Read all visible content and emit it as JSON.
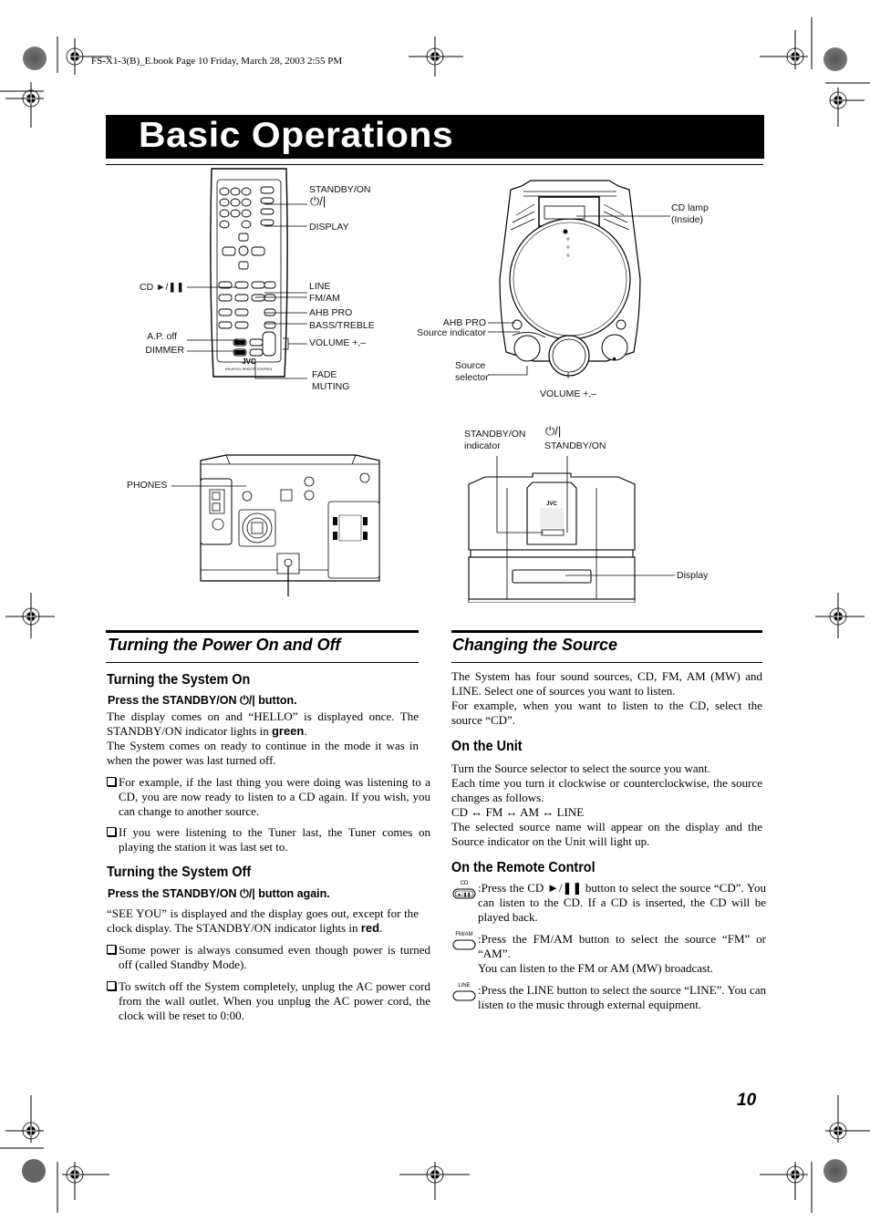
{
  "print_header": "FS-X1-3(B)_E.book  Page 10  Friday, March 28, 2003  2:55 PM",
  "page_title": "Basic Operations",
  "page_number": "10",
  "remote_diagram": {
    "labels": {
      "standby_on": "STANDBY/ON",
      "standby_symbol": "⏻/|",
      "display": "DISPLAY",
      "cd_play_pause": "CD ►/❚❚",
      "line": "LINE",
      "fm_am": "FM/AM",
      "ahb_pro": "AHB PRO",
      "bass_treble": "BASS/TREBLE",
      "ap_off": "A.P. off",
      "dimmer": "DIMMER",
      "volume": "VOLUME +,–",
      "fade_muting_1": "FADE",
      "fade_muting_2": "MUTING"
    },
    "brand": "JVC"
  },
  "unit_top_diagram": {
    "labels": {
      "cd_lamp_1": "CD lamp",
      "cd_lamp_2": "(Inside)",
      "ahb_pro": "AHB PRO",
      "source_indicator": "Source indicator",
      "source_selector_1": "Source",
      "source_selector_2": "selector",
      "volume": "VOLUME +,–"
    }
  },
  "unit_back_diagram": {
    "labels": {
      "phones": "PHONES"
    }
  },
  "unit_front_diagram": {
    "labels": {
      "indicator_1": "STANDBY/ON",
      "indicator_2": "indicator",
      "button_symbol": "⏻/|",
      "button": "STANDBY/ON",
      "display": "Display"
    },
    "brand": "JVC"
  },
  "power_section": {
    "title": "Turning the Power On and Off",
    "on": {
      "heading": "Turning the System On",
      "instruction": "Press the STANDBY/ON ⏻/| button.",
      "para1_a": "The display comes on and “HELLO” is displayed once. The STANDBY/ON indicator lights in ",
      "para1_color": "green",
      "para1_b": ".",
      "para2": "The System comes on ready to continue in the mode it was in when the power was last turned off.",
      "bullets": [
        "For example, if the last thing you were doing was listening to a CD, you are now ready to listen to a CD again. If you wish, you can change to another source.",
        "If you were listening to the Tuner last, the Tuner comes on playing the station it was last set to."
      ]
    },
    "off": {
      "heading": "Turning the System Off",
      "instruction": "Press the STANDBY/ON ⏻/| button again.",
      "para1_a": "“SEE YOU” is displayed and the display goes out, except for the clock display. The STANDBY/ON indicator lights in ",
      "para1_color": "red",
      "para1_b": ".",
      "bullets": [
        "Some power is always consumed even though power is turned off (called Standby Mode).",
        "To switch off the System completely, unplug the AC power cord from the wall outlet. When you unplug the AC power cord, the clock will be reset to 0:00."
      ]
    }
  },
  "source_section": {
    "title": "Changing the Source",
    "intro1": "The System has four sound sources, CD, FM, AM (MW) and LINE. Select one of sources you want to listen.",
    "intro2": "For example, when you want to listen to the CD, select the source “CD”.",
    "unit": {
      "heading": "On the Unit",
      "para1": "Turn the Source selector to select the source you want.",
      "para2": "Each time you turn it clockwise or counterclockwise, the source changes as follows.",
      "sequence": "CD ↔ FM ↔ AM ↔ LINE",
      "para3": "The selected source name will appear on the display and the Source indicator on the Unit will light up."
    },
    "remote": {
      "heading": "On the Remote Control",
      "items": [
        {
          "icon_caption": "CD",
          "icon_glyph": "►/❚❚",
          "text": ":Press the CD ►/❚❚ button to select the source “CD”. You can listen to the CD. If a CD is inserted, the CD will be played back."
        },
        {
          "icon_caption": "FM/AM",
          "icon_glyph": "",
          "text": ":Press the FM/AM button to select the source “FM” or “AM”.",
          "text2": "You can listen to the FM or AM (MW) broadcast."
        },
        {
          "icon_caption": "LINE",
          "icon_glyph": "",
          "text": ":Press the LINE button to select the source “LINE”. You can listen to the music through external equipment."
        }
      ]
    }
  }
}
